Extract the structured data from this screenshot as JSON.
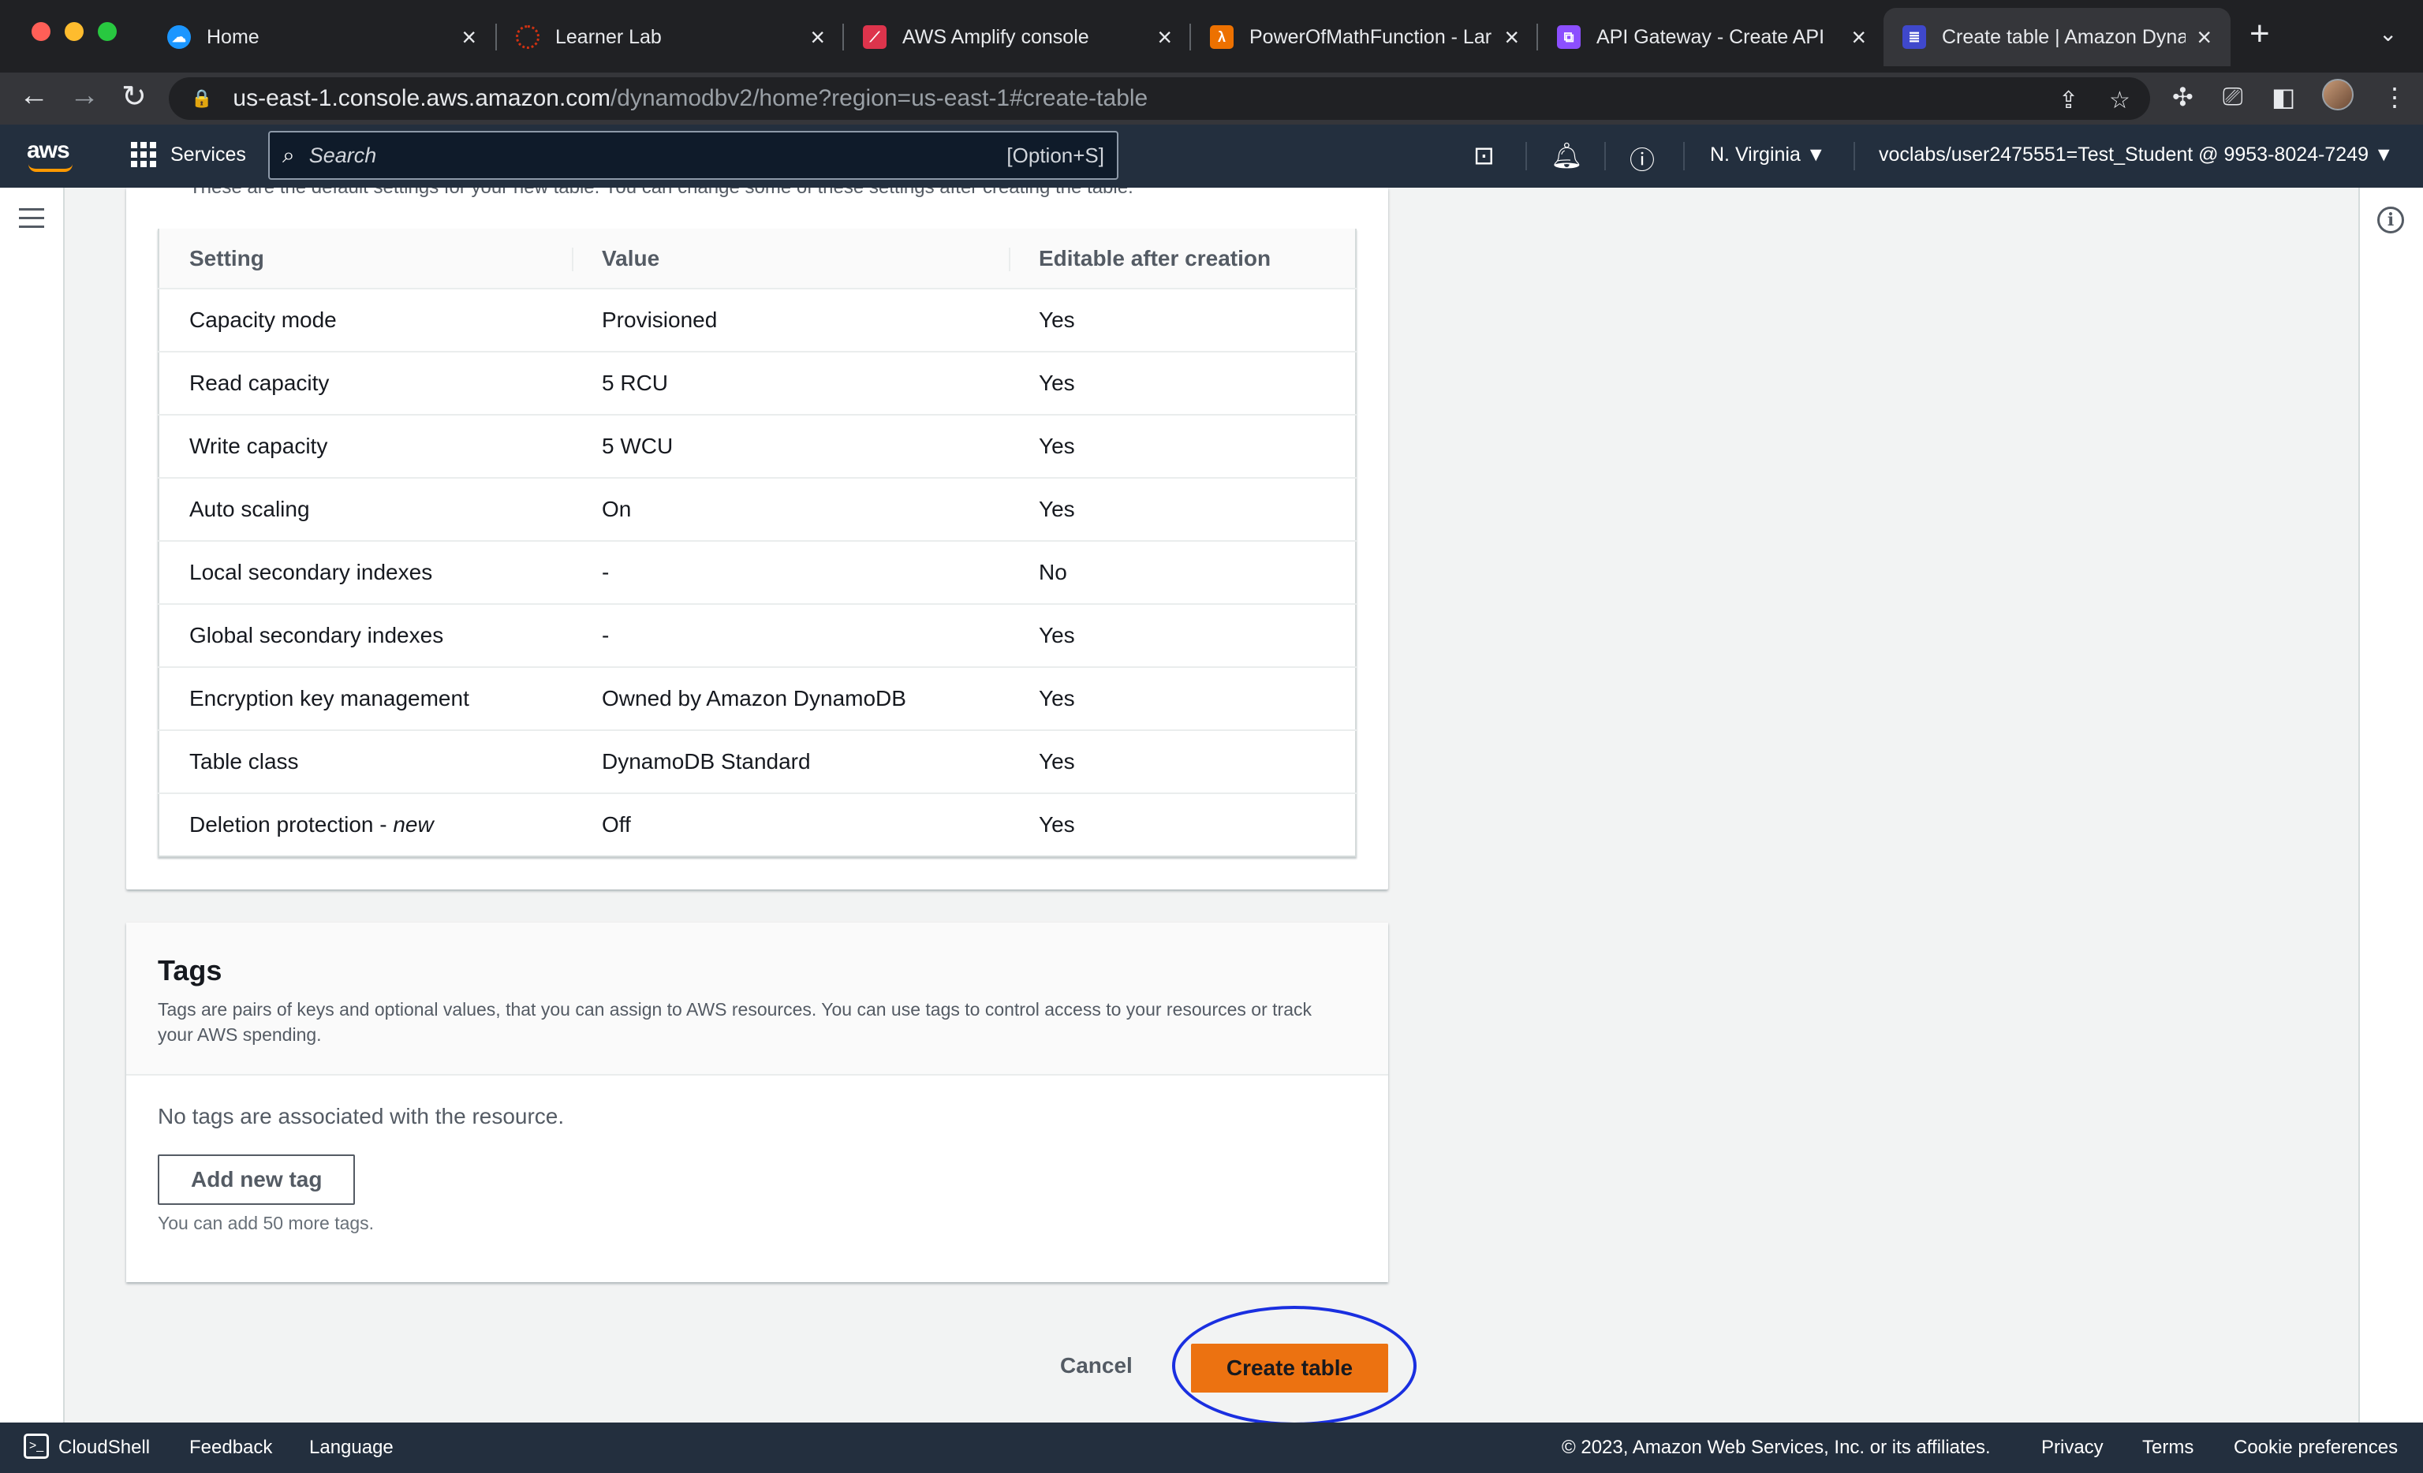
{
  "browser": {
    "tabs": [
      {
        "title": "Home",
        "icon": "salesforce-cloud-icon",
        "color": "#1b96ff"
      },
      {
        "title": "Learner Lab",
        "icon": "learner-lab-icon",
        "color": "#d13212"
      },
      {
        "title": "AWS Amplify console",
        "icon": "amplify-icon",
        "color": "#dd344c"
      },
      {
        "title": "PowerOfMathFunction - Lar",
        "icon": "lambda-icon",
        "color": "#ed7100"
      },
      {
        "title": "API Gateway - Create API",
        "icon": "api-gateway-icon",
        "color": "#8c4fff"
      },
      {
        "title": "Create table | Amazon Dyna",
        "icon": "dynamodb-icon",
        "color": "#3f48cc"
      }
    ],
    "url_host": "us-east-1.console.aws.amazon.com",
    "url_path": "/dynamodbv2/home?region=us-east-1#create-table"
  },
  "awsnav": {
    "logo": "aws",
    "services_label": "Services",
    "search_placeholder": "Search",
    "search_shortcut": "[Option+S]",
    "region": "N. Virginia ▼",
    "account": "voclabs/user2475551=Test_Student @ 9953-8024-7249 ▼"
  },
  "settings": {
    "clipped_text": "These are the default settings for your new table. You can change some of these settings after creating the table.",
    "columns": [
      "Setting",
      "Value",
      "Editable after creation"
    ],
    "rows": [
      {
        "setting": "Capacity mode",
        "value": "Provisioned",
        "editable": "Yes"
      },
      {
        "setting": "Read capacity",
        "value": "5 RCU",
        "editable": "Yes"
      },
      {
        "setting": "Write capacity",
        "value": "5 WCU",
        "editable": "Yes"
      },
      {
        "setting": "Auto scaling",
        "value": "On",
        "editable": "Yes"
      },
      {
        "setting": "Local secondary indexes",
        "value": "-",
        "editable": "No"
      },
      {
        "setting": "Global secondary indexes",
        "value": "-",
        "editable": "Yes"
      },
      {
        "setting": "Encryption key management",
        "value": "Owned by Amazon DynamoDB",
        "editable": "Yes"
      },
      {
        "setting": "Table class",
        "value": "DynamoDB Standard",
        "editable": "Yes"
      },
      {
        "setting": "Deletion protection - ",
        "setting_suffix": "new",
        "value": "Off",
        "editable": "Yes"
      }
    ]
  },
  "tags": {
    "title": "Tags",
    "description": "Tags are pairs of keys and optional values, that you can assign to AWS resources. You can use tags to control access to your resources or track your AWS spending.",
    "empty": "No tags are associated with the resource.",
    "add_button": "Add new tag",
    "hint": "You can add 50 more tags."
  },
  "actions": {
    "cancel": "Cancel",
    "create": "Create table"
  },
  "footer": {
    "cloudshell": "CloudShell",
    "feedback": "Feedback",
    "language": "Language",
    "copyright": "© 2023, Amazon Web Services, Inc. or its affiliates.",
    "privacy": "Privacy",
    "terms": "Terms",
    "cookies": "Cookie preferences"
  }
}
